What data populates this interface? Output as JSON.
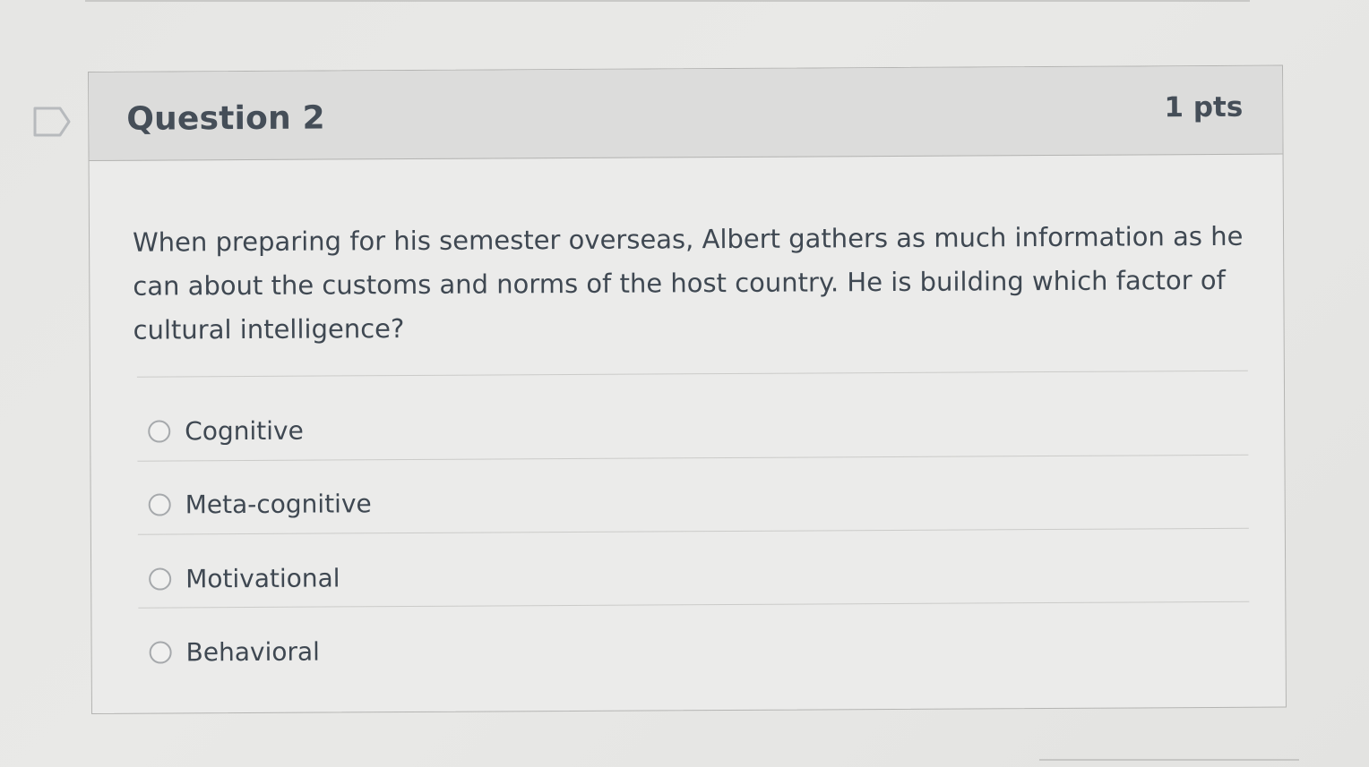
{
  "question": {
    "title": "Question 2",
    "points": "1 pts",
    "text": "When preparing for his semester overseas, Albert gathers as much information as he can about the customs and norms of the host country. He is building which factor of cultural intelligence?"
  },
  "answers": [
    {
      "label": "Cognitive",
      "selected": false
    },
    {
      "label": "Meta-cognitive",
      "selected": false
    },
    {
      "label": "Motivational",
      "selected": false
    },
    {
      "label": "Behavioral",
      "selected": false
    }
  ],
  "icons": {
    "flag": "flag-bookmark-icon",
    "radio": "radio-button-icon"
  }
}
